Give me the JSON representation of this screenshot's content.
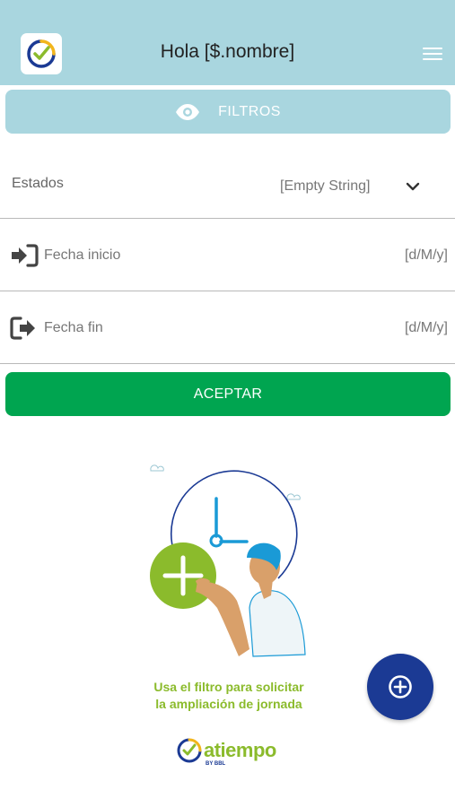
{
  "header": {
    "title": "Hola [$.nombre]",
    "app_icon": "atiempo-check-icon",
    "menu_icon": "hamburger-menu-icon"
  },
  "filters": {
    "label": "FILTROS",
    "icon": "eye-icon"
  },
  "form": {
    "states": {
      "label": "Estados",
      "value": "[Empty String]",
      "icon": "chevron-down-icon"
    },
    "start_date": {
      "label": "Fecha inicio",
      "value": "[d/M/y]",
      "icon": "sign-in-icon"
    },
    "end_date": {
      "label": "Fecha fin",
      "value": "[d/M/y]",
      "icon": "sign-out-icon"
    }
  },
  "accept_label": "ACEPTAR",
  "hint": {
    "line1": "Usa el filtro para solicitar",
    "line2": "la ampliación de jornada"
  },
  "fab_icon": "plus-circle-icon",
  "footer": {
    "brand": "atiempo",
    "subtitle": "BY BBL"
  },
  "colors": {
    "header": "#a9d6df",
    "accept": "#00a550",
    "fab": "#1b3a94",
    "brand_green": "#8bbb2c"
  }
}
